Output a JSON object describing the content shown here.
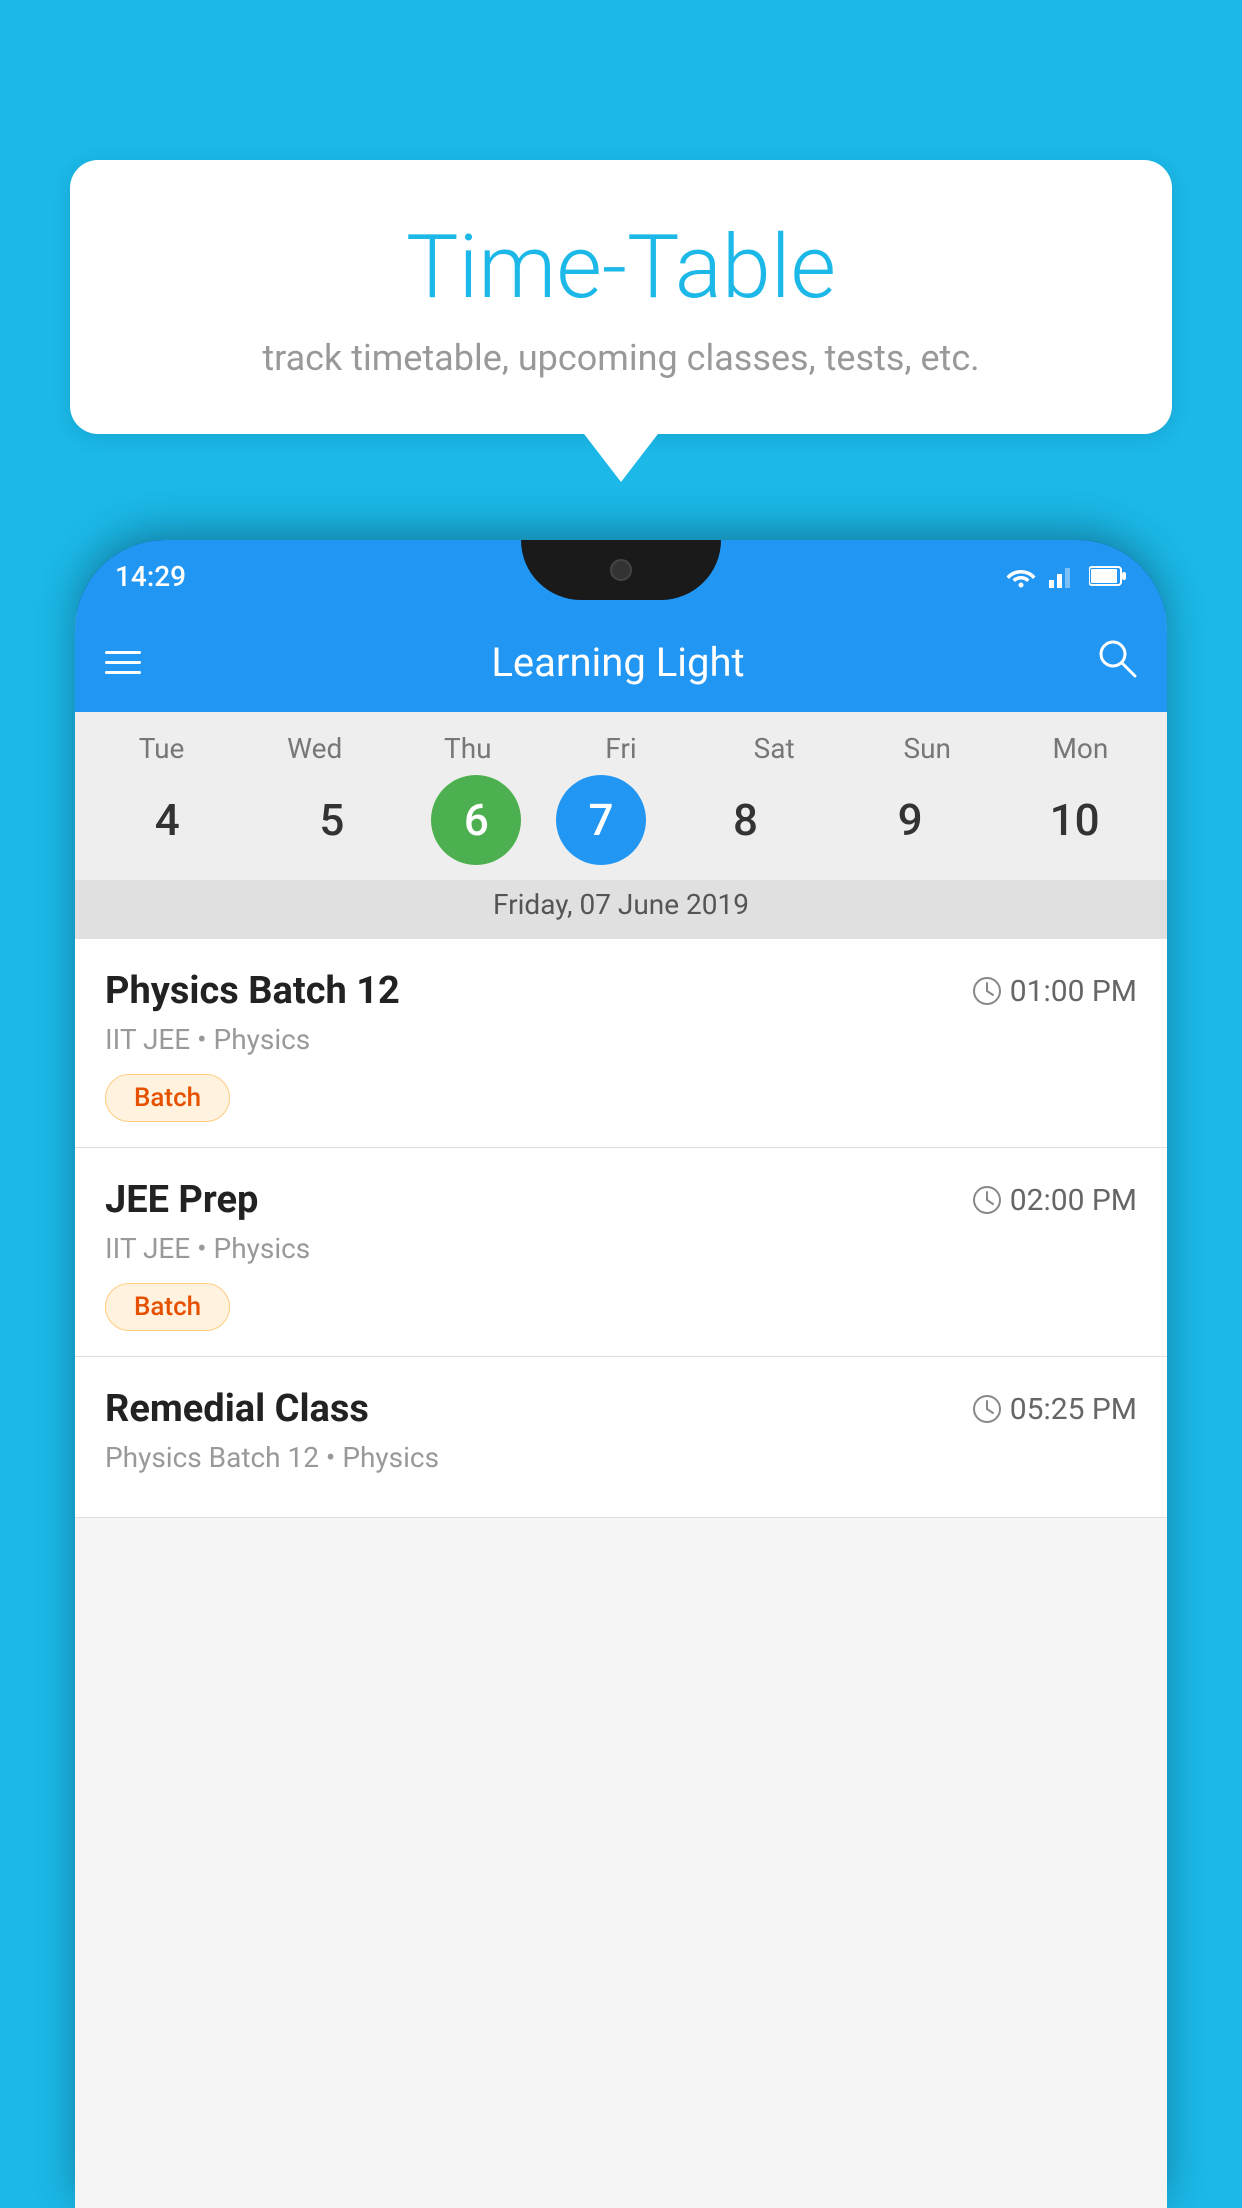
{
  "background_color": "#1BB8E8",
  "bubble": {
    "title": "Time-Table",
    "subtitle": "track timetable, upcoming classes, tests, etc."
  },
  "phone": {
    "status_bar": {
      "time": "14:29"
    },
    "app_bar": {
      "title": "Learning Light"
    },
    "calendar": {
      "days": [
        {
          "short": "Tue",
          "num": "4"
        },
        {
          "short": "Wed",
          "num": "5"
        },
        {
          "short": "Thu",
          "num": "6",
          "state": "today"
        },
        {
          "short": "Fri",
          "num": "7",
          "state": "selected"
        },
        {
          "short": "Sat",
          "num": "8"
        },
        {
          "short": "Sun",
          "num": "9"
        },
        {
          "short": "Mon",
          "num": "10"
        }
      ],
      "selected_date_label": "Friday, 07 June 2019"
    },
    "schedule": [
      {
        "title": "Physics Batch 12",
        "time": "01:00 PM",
        "subtitle": "IIT JEE • Physics",
        "tag": "Batch"
      },
      {
        "title": "JEE Prep",
        "time": "02:00 PM",
        "subtitle": "IIT JEE • Physics",
        "tag": "Batch"
      },
      {
        "title": "Remedial Class",
        "time": "05:25 PM",
        "subtitle": "Physics Batch 12 • Physics",
        "tag": null
      }
    ]
  }
}
